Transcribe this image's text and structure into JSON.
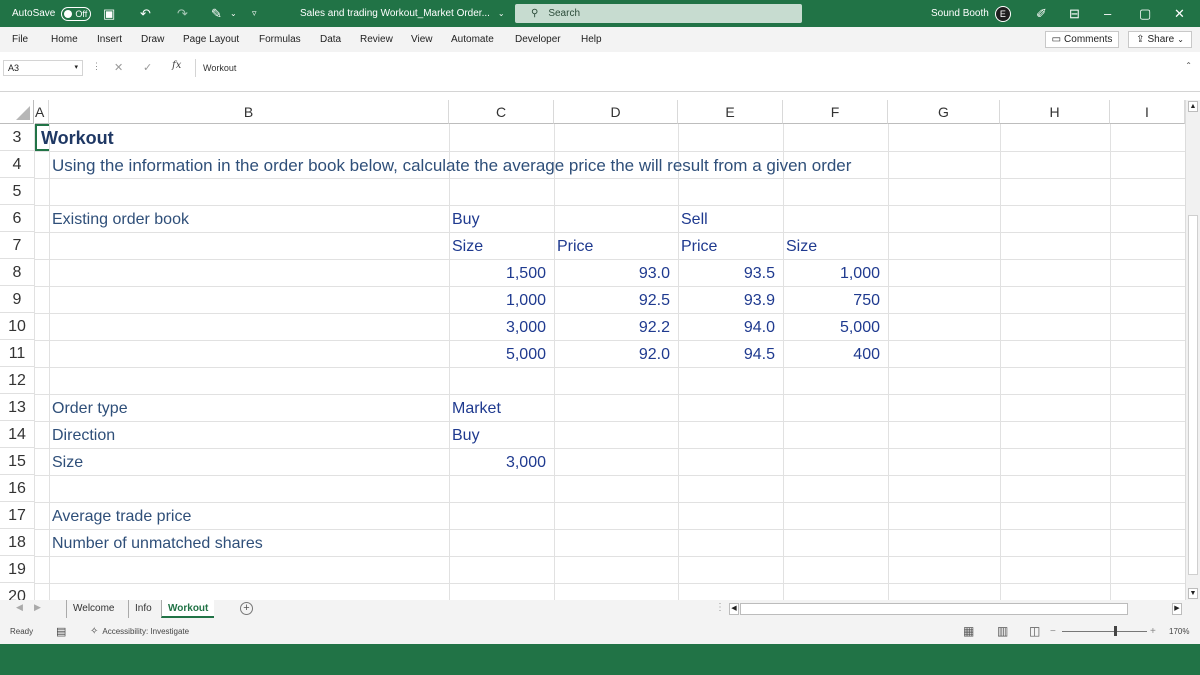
{
  "titlebar": {
    "autosave_label": "AutoSave",
    "autosave_state": "Off",
    "doc_title": "Sales and trading Workout_Market Order...",
    "search_placeholder": "Search",
    "user_name": "Sound Booth",
    "user_initial": "E"
  },
  "menu": {
    "items": [
      "File",
      "Home",
      "Insert",
      "Draw",
      "Page Layout",
      "Formulas",
      "Data",
      "Review",
      "View",
      "Automate",
      "Developer",
      "Help"
    ],
    "comments_label": "Comments",
    "share_label": "Share"
  },
  "formula_bar": {
    "name_box": "A3",
    "fx_label": "fx",
    "content": "Workout"
  },
  "columns": [
    "A",
    "B",
    "C",
    "D",
    "E",
    "F",
    "G",
    "H",
    "I"
  ],
  "rows": [
    "3",
    "4",
    "5",
    "6",
    "7",
    "8",
    "9",
    "10",
    "11",
    "12",
    "13",
    "14",
    "15",
    "16",
    "17",
    "18",
    "19",
    "20"
  ],
  "sheet": {
    "title": "Workout",
    "instruction": "Using the information in the order book below, calculate the average price the will result from a given order",
    "existing_order_book": "Existing order book",
    "buy_header": "Buy",
    "sell_header": "Sell",
    "buy_size_header": "Size",
    "buy_price_header": "Price",
    "sell_price_header": "Price",
    "sell_size_header": "Size",
    "order_book": [
      {
        "buy_size": "1,500",
        "buy_price": "93.0",
        "sell_price": "93.5",
        "sell_size": "1,000"
      },
      {
        "buy_size": "1,000",
        "buy_price": "92.5",
        "sell_price": "93.9",
        "sell_size": "750"
      },
      {
        "buy_size": "3,000",
        "buy_price": "92.2",
        "sell_price": "94.0",
        "sell_size": "5,000"
      },
      {
        "buy_size": "5,000",
        "buy_price": "92.0",
        "sell_price": "94.5",
        "sell_size": "400"
      }
    ],
    "order_type_label": "Order type",
    "order_type_value": "Market",
    "direction_label": "Direction",
    "direction_value": "Buy",
    "size_label": "Size",
    "size_value": "3,000",
    "avg_price_label": "Average trade price",
    "unmatched_label": "Number of unmatched shares"
  },
  "tabs": [
    "Welcome",
    "Info",
    "Workout"
  ],
  "active_tab": "Workout",
  "status": {
    "ready": "Ready",
    "accessibility": "Accessibility: Investigate",
    "zoom": "170%"
  },
  "colors": {
    "excel_green": "#217346",
    "cell_text": "#1f3a8f"
  }
}
